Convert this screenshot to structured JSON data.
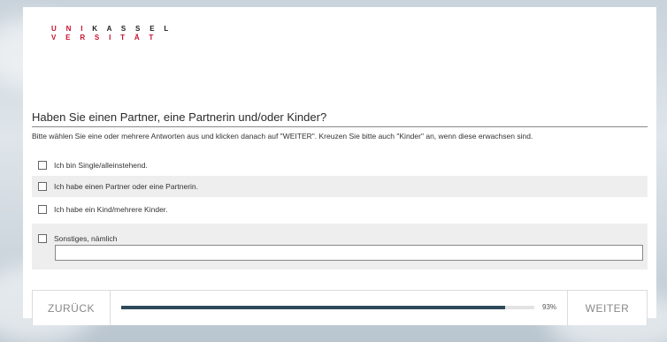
{
  "logo": {
    "line1_red": "U N I",
    "line1_dark": "K A S S E L",
    "line2": "V E R S I T Ä T"
  },
  "question": "Haben Sie einen Partner, eine Partnerin und/oder Kinder?",
  "instruction": "Bitte wählen Sie eine oder mehrere Antworten aus und klicken danach auf \"WEITER\". Kreuzen Sie bitte auch \"Kinder\" an, wenn diese erwachsen sind.",
  "options": [
    {
      "label": "Ich bin Single/alleinstehend.",
      "checked": false
    },
    {
      "label": "Ich habe einen Partner oder eine Partnerin.",
      "checked": false
    },
    {
      "label": "Ich habe ein Kind/mehrere Kinder.",
      "checked": false
    }
  ],
  "other": {
    "label": "Sonstiges, nämlich",
    "value": "",
    "checked": false
  },
  "navigation": {
    "back_label": "ZURÜCK",
    "next_label": "WEITER",
    "progress_text": "93%",
    "progress_fraction": 0.93
  },
  "colors": {
    "logo_red": "#c8102e",
    "progress_fill": "#2e4a5a"
  }
}
